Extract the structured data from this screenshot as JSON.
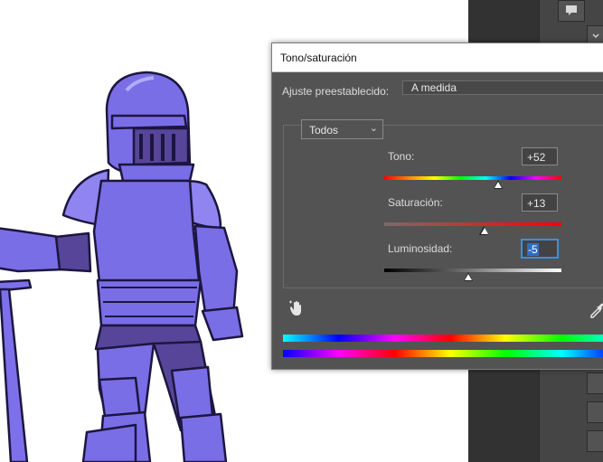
{
  "dialog": {
    "title": "Tono/saturación",
    "preset_label": "Ajuste preestablecido:",
    "preset_value": "A medida",
    "channel": "Todos",
    "channel_chevron": "⌄"
  },
  "sliders": [
    {
      "label": "Tono:",
      "value": "+52",
      "numeric": 52,
      "min": -180,
      "max": 180
    },
    {
      "label": "Saturación:",
      "value": "+13",
      "numeric": 13,
      "min": -100,
      "max": 100
    },
    {
      "label": "Luminosidad:",
      "value": "-5",
      "numeric": -5,
      "min": -100,
      "max": 100
    }
  ],
  "icons": {
    "hand_tool": "hand-adjust-icon",
    "eyedropper": "eyedropper-icon",
    "comment": "comment-icon",
    "chevron": "chevron-down-icon"
  },
  "colors": {
    "dialog_bg": "#535353",
    "title_bg": "#ffffff",
    "knight": "#7a6ee6",
    "knight_dark": "#574599",
    "focus": "#3d8ee0"
  }
}
